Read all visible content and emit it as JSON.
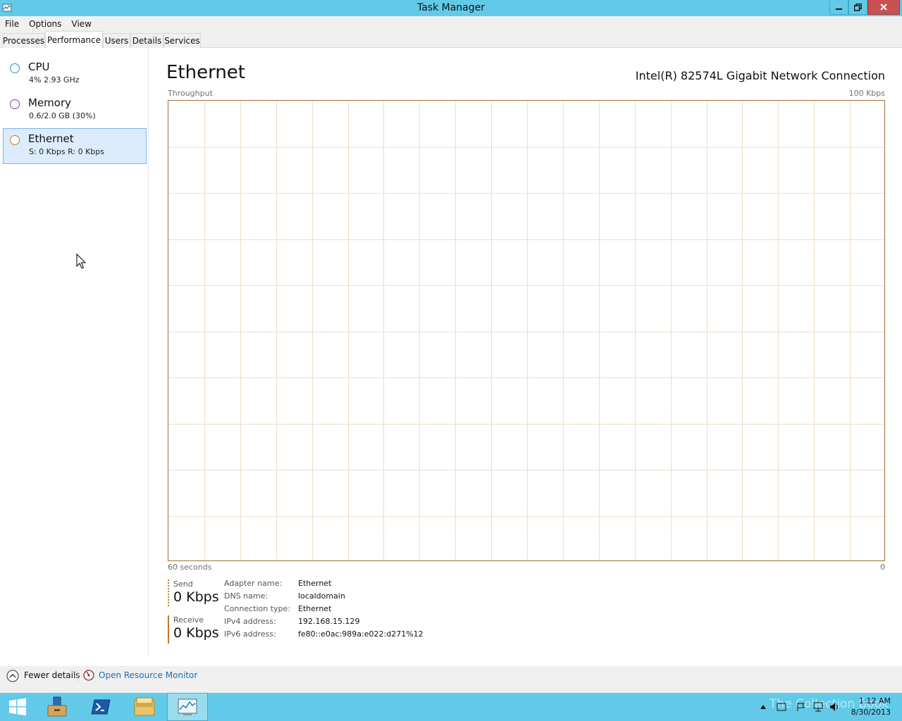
{
  "window": {
    "title": "Task Manager"
  },
  "menu": {
    "file": "File",
    "options": "Options",
    "view": "View"
  },
  "tabs": [
    "Processes",
    "Performance",
    "Users",
    "Details",
    "Services"
  ],
  "sidebar": {
    "items": [
      {
        "name": "CPU",
        "sub": "4%  2.93 GHz",
        "color": "#2d8ecf"
      },
      {
        "name": "Memory",
        "sub": "0.6/2.0 GB (30%)",
        "color": "#9b33b5"
      },
      {
        "name": "Ethernet",
        "sub": "S: 0 Kbps R: 0 Kbps",
        "color": "#c37b2c"
      }
    ]
  },
  "main": {
    "title": "Ethernet",
    "adapter": "Intel(R) 82574L Gigabit Network Connection",
    "graph": {
      "top_left": "Throughput",
      "top_right": "100 Kbps",
      "bottom_left": "60 seconds",
      "bottom_right": "0",
      "border_color": "#a0713c",
      "grid_color": "#f1ddc8"
    },
    "send": {
      "label": "Send",
      "value": "0 Kbps"
    },
    "receive": {
      "label": "Receive",
      "value": "0 Kbps"
    },
    "properties": [
      {
        "key": "Adapter name:",
        "value": "Ethernet"
      },
      {
        "key": "DNS name:",
        "value": "localdomain"
      },
      {
        "key": "Connection type:",
        "value": "Ethernet"
      },
      {
        "key": "IPv4 address:",
        "value": "192.168.15.129"
      },
      {
        "key": "IPv6 address:",
        "value": "fe80::e0ac:989a:e022:d271%12"
      }
    ]
  },
  "footer": {
    "fewer_details": "Fewer details",
    "resource_monitor": "Open Resource Monitor"
  },
  "taskbar": {
    "apps": [
      "start-icon",
      "server-manager-icon",
      "powershell-icon",
      "file-explorer-icon",
      "task-manager-icon"
    ],
    "clock_time": "1:12 AM",
    "clock_date": "8/30/2013",
    "watermark": "The Collection Book"
  }
}
